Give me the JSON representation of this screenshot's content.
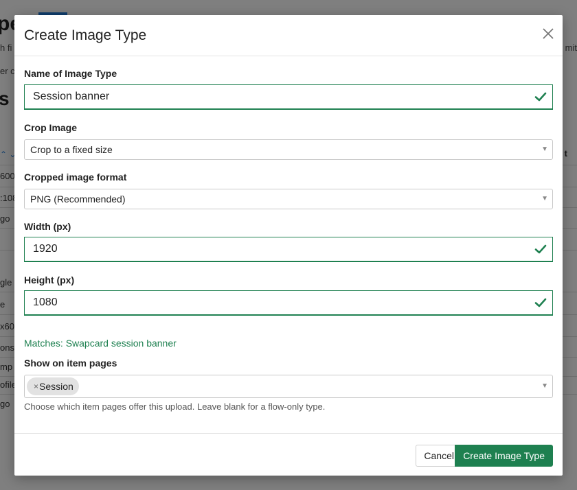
{
  "background": {
    "title_fragment": "pe",
    "sub_fragment": "h fi",
    "sub_right_fragment": "mit",
    "sub2_fragment": "er c",
    "heading_fragment": "s",
    "column_right_fragment": "t",
    "rows": [
      "600",
      ":108",
      "go",
      "",
      "gle",
      "e",
      "x60",
      "ons",
      "mp",
      "ofile",
      "go"
    ]
  },
  "modal": {
    "title": "Create Image Type",
    "close_icon": "close-icon",
    "fields": {
      "name": {
        "label": "Name of Image Type",
        "value": "Session banner",
        "valid": true
      },
      "crop": {
        "label": "Crop Image",
        "selected": "Crop to a fixed size"
      },
      "format": {
        "label": "Cropped image format",
        "selected": "PNG (Recommended)"
      },
      "width": {
        "label": "Width (px)",
        "value": "1920",
        "valid": true
      },
      "height": {
        "label": "Height (px)",
        "value": "1080",
        "valid": true
      }
    },
    "match_note": "Matches: Swapcard session banner",
    "show_on": {
      "label": "Show on item pages",
      "tags": [
        "Session"
      ],
      "help": "Choose which item pages offer this upload. Leave blank for a flow-only type."
    },
    "buttons": {
      "cancel": "Cancel",
      "create": "Create Image Type"
    }
  },
  "colors": {
    "accent": "#1e8050",
    "overlay": "rgba(0,0,0,0.5)"
  }
}
